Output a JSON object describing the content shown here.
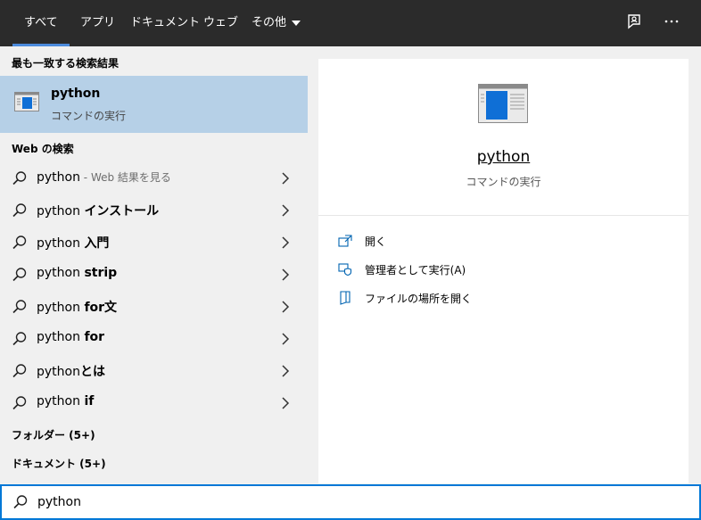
{
  "tabs": [
    {
      "label": "すべて"
    },
    {
      "label": "アプリ"
    },
    {
      "label": "ドキュメント"
    },
    {
      "label": "ウェブ"
    },
    {
      "label": "その他"
    }
  ],
  "left": {
    "best_match_header": "最も一致する検索結果",
    "best_match": {
      "title": "python",
      "subtitle": "コマンドの実行"
    },
    "web_header": "Web の検索",
    "web_results": [
      {
        "bold": "",
        "text": "python",
        "suffix": " - Web 結果を見る"
      },
      {
        "text": "python ",
        "bold": "インストール",
        "suffix": ""
      },
      {
        "text": "python ",
        "bold": "入門",
        "suffix": ""
      },
      {
        "text": "python ",
        "bold": "strip",
        "suffix": ""
      },
      {
        "text": "python ",
        "bold": "for文",
        "suffix": ""
      },
      {
        "text": "python ",
        "bold": "for",
        "suffix": ""
      },
      {
        "text": "python",
        "bold": "とは",
        "suffix": ""
      },
      {
        "text": "python ",
        "bold": "if",
        "suffix": ""
      }
    ],
    "folders_header": "フォルダー (5+)",
    "documents_header": "ドキュメント (5+)"
  },
  "preview": {
    "name": "python",
    "description": "コマンドの実行",
    "actions": [
      {
        "label": "開く",
        "icon": "open-icon"
      },
      {
        "label": "管理者として実行(A)",
        "icon": "shield-icon"
      },
      {
        "label": "ファイルの場所を開く",
        "icon": "file-location-icon"
      }
    ]
  },
  "search": {
    "value": "python"
  },
  "colors": {
    "topbar": "#2b2b2b",
    "accent": "#0078d7",
    "selected": "#b6d0e7"
  }
}
